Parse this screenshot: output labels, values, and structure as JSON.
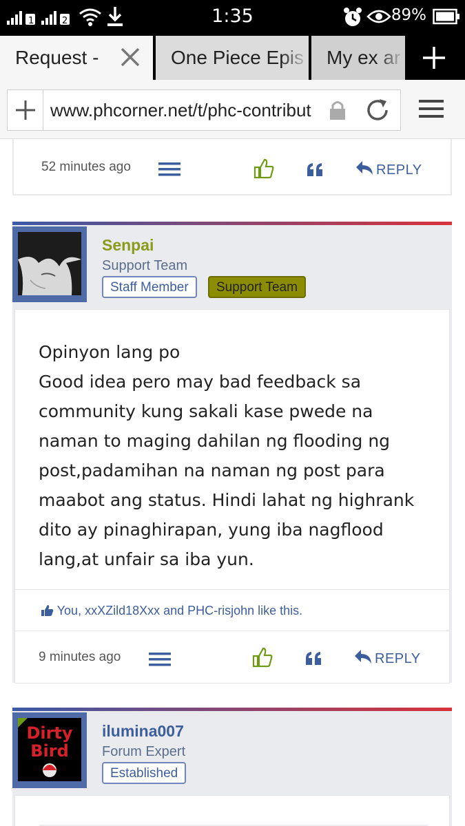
{
  "statusbar": {
    "time": "1:35",
    "battery": "89%"
  },
  "tabs": [
    {
      "label": "Request -"
    },
    {
      "label": "One Piece Epis"
    },
    {
      "label": "My ex ar"
    }
  ],
  "urlbar": {
    "url": "www.phcorner.net/t/phc-contribut"
  },
  "top_post": {
    "time_ago": "52 minutes ago",
    "reply_label": "REPLY"
  },
  "post1": {
    "username": "Senpai",
    "user_title": "Support Team",
    "badges": [
      "Staff Member",
      "Support Team"
    ],
    "message": "Opinyon lang po\nGood idea pero may bad feedback sa\ncommunity kung sakali kase pwede na\nnaman to maging dahilan ng flooding ng\npost,padamihan na naman ng post para\nmaabot ang status. Hindi lahat ng highrank\ndito ay pinaghirapan, yung iba nagflood\nlang,at unfair sa iba yun.",
    "likes_text": "You, xxXZild18Xxx and PHC-risjohn like this.",
    "time_ago": "9 minutes ago",
    "reply_label": "REPLY",
    "colors": {
      "username": "#8a9a1a"
    }
  },
  "post2": {
    "username": "ilumina007",
    "user_title": "Forum Expert",
    "badge": "Established",
    "avatar_text": [
      "Dirty",
      "Bird"
    ],
    "colors": {
      "username": "#3d5e9c"
    }
  }
}
